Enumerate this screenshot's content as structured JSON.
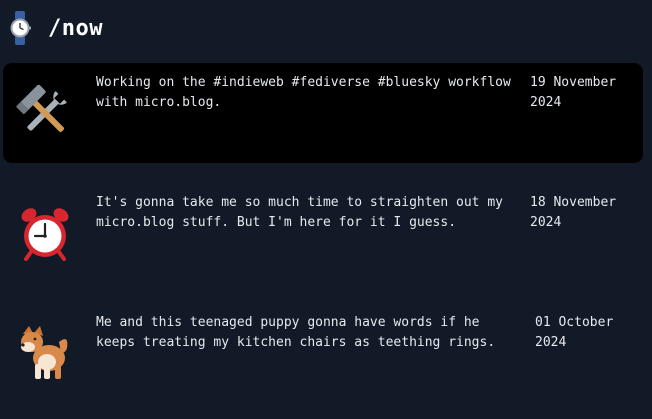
{
  "header": {
    "icon": "watch-icon",
    "title": "/now"
  },
  "entries": [
    {
      "icon": "hammer-and-wrench-icon",
      "text": "Working on the #indieweb #fediverse #bluesky workflow\nwith micro.blog.",
      "date": "19 November\n2024",
      "highlighted": true
    },
    {
      "icon": "alarm-clock-icon",
      "text": "It's gonna take me so much time to straighten out my\nmicro.blog stuff. But I'm here for it I guess.",
      "date": "18 November\n2024",
      "highlighted": false
    },
    {
      "icon": "dog-icon",
      "text": "Me and this teenaged puppy gonna have words if he\nkeeps treating my kitchen chairs as teething rings.",
      "date": "01 October\n2024",
      "highlighted": false
    }
  ],
  "colors": {
    "background": "#121a27",
    "highlight": "#000000",
    "text": "#e6e9ee"
  }
}
